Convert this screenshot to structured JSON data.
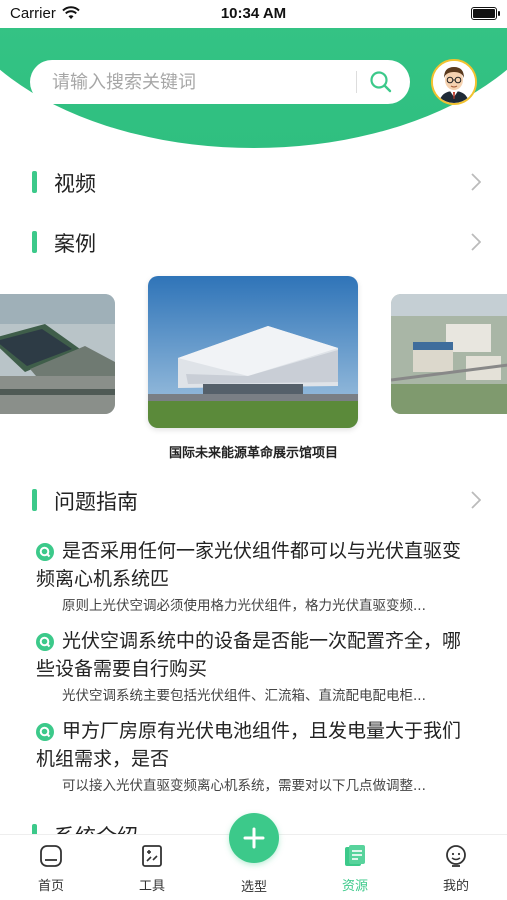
{
  "status_bar": {
    "carrier": "Carrier",
    "time": "10:34 AM"
  },
  "search": {
    "placeholder": "请输入搜索关键词"
  },
  "sections": {
    "video": {
      "title": "视频"
    },
    "cases": {
      "title": "案例"
    },
    "guide": {
      "title": "问题指南"
    },
    "intro": {
      "title": "系统介绍"
    }
  },
  "carousel": {
    "caption": "国际未来能源革命展示馆项目"
  },
  "questions": [
    {
      "title": "是否采用任何一家光伏组件都可以与光伏直驱变频离心机系统匹",
      "summary": "原则上光伏空调必须使用格力光伏组件，格力光伏直驱变频..."
    },
    {
      "title": "光伏空调系统中的设备是否能一次配置齐全，哪些设备需要自行购买",
      "summary": "光伏空调系统主要包括光伏组件、汇流箱、直流配电配电柜..."
    },
    {
      "title": "甲方厂房原有光伏电池组件，且发电量大于我们机组需求，是否",
      "summary": "可以接入光伏直驱变频离心机系统，需要对以下几点做调整..."
    }
  ],
  "tabs": [
    {
      "label": "首页",
      "icon": "home-icon"
    },
    {
      "label": "工具",
      "icon": "tools-icon"
    },
    {
      "label": "选型",
      "icon": "plus-icon"
    },
    {
      "label": "资源",
      "icon": "resources-icon",
      "active": true
    },
    {
      "label": "我的",
      "icon": "profile-icon"
    }
  ],
  "colors": {
    "accent": "#3cc98a",
    "header": "#33c184"
  }
}
